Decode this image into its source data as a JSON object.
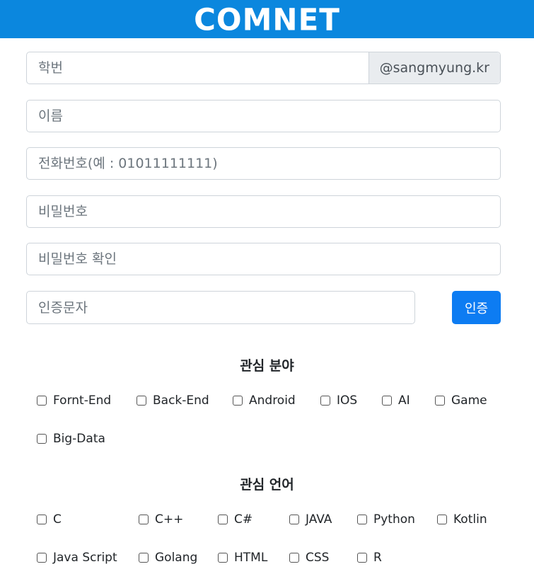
{
  "header": {
    "brand": "COMNET"
  },
  "form": {
    "student_id": {
      "placeholder": "학번",
      "suffix": "@sangmyung.kr"
    },
    "name": {
      "placeholder": "이름"
    },
    "phone": {
      "placeholder": "전화번호(예 : 01011111111)"
    },
    "password": {
      "placeholder": "비밀번호"
    },
    "password_confirm": {
      "placeholder": "비밀번호 확인"
    },
    "verification": {
      "placeholder": "인증문자",
      "button_label": "인증"
    }
  },
  "interests": {
    "title": "관심 분야",
    "options": [
      "Fornt-End",
      "Back-End",
      "Android",
      "IOS",
      "AI",
      "Game",
      "Big-Data"
    ]
  },
  "languages": {
    "title": "관심 언어",
    "options": [
      "C",
      "C++",
      "C#",
      "JAVA",
      "Python",
      "Kotlin",
      "Java Script",
      "Golang",
      "HTML",
      "CSS",
      "R"
    ]
  },
  "colors": {
    "header": "#0b87de",
    "button": "#0d7cf2"
  }
}
